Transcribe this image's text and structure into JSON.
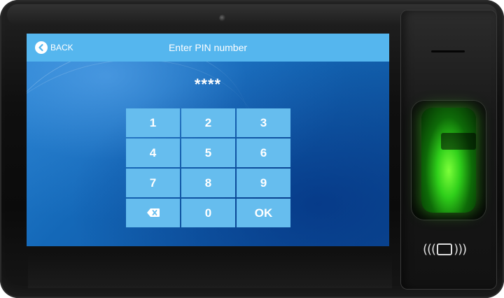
{
  "header": {
    "back_label": "BACK",
    "title": "Enter PIN number"
  },
  "pin_display": "****",
  "keypad": {
    "keys": [
      "1",
      "2",
      "3",
      "4",
      "5",
      "6",
      "7",
      "8",
      "9",
      "0",
      "OK"
    ]
  },
  "icons": {
    "back": "back-arrow-icon",
    "delete": "backspace-icon",
    "rfid": "rfid-card-icon"
  },
  "colors": {
    "header_bg": "#55b6ee",
    "key_bg": "#66bdee",
    "screen_bg": "#1468b8",
    "sensor_glow": "#2fcf1a"
  }
}
